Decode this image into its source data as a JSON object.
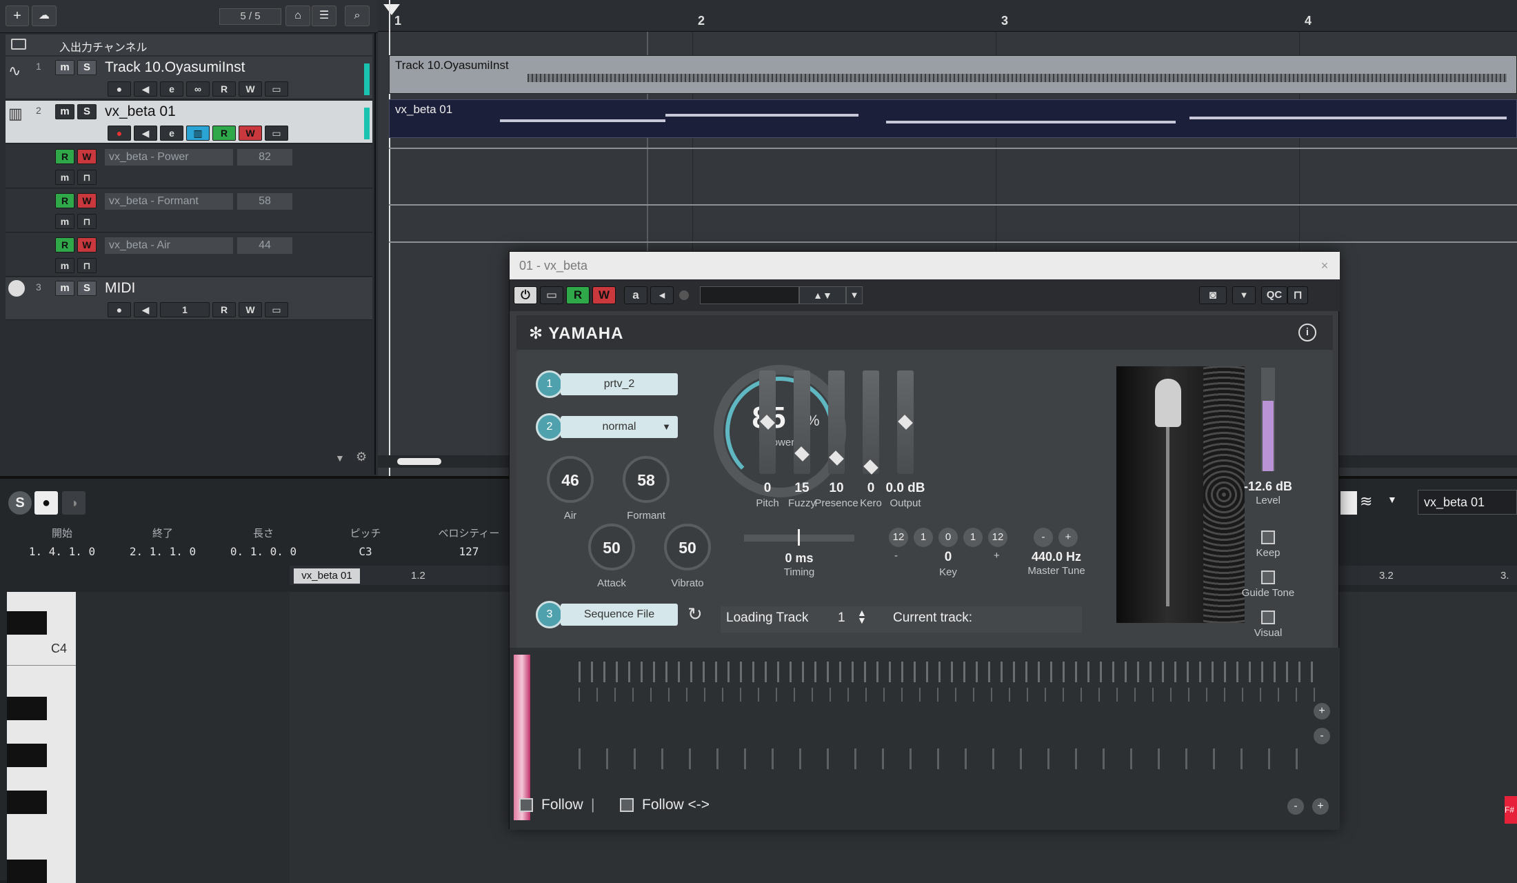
{
  "toolbar": {
    "add_label": "+",
    "counter": "5 / 5"
  },
  "track_list": {
    "folder_label": "入出力チャンネル",
    "tracks": [
      {
        "num": "1",
        "name": "Track 10.OyasumiInst",
        "m": "m",
        "s": "S",
        "r": "R",
        "w": "W"
      },
      {
        "num": "2",
        "name": "vx_beta 01",
        "m": "m",
        "s": "S",
        "r": "R",
        "w": "W"
      },
      {
        "num": "3",
        "name": "MIDI",
        "m": "m",
        "s": "S",
        "r": "R",
        "w": "W",
        "channel": "1"
      }
    ],
    "lanes": [
      {
        "name": "vx_beta - Power",
        "value": "82",
        "r": "R",
        "w": "W"
      },
      {
        "name": "vx_beta - Formant",
        "value": "58",
        "r": "R",
        "w": "W"
      },
      {
        "name": "vx_beta - Air",
        "value": "44",
        "r": "R",
        "w": "W"
      }
    ]
  },
  "ruler": {
    "bars": [
      "1",
      "2",
      "3",
      "4"
    ]
  },
  "clips": {
    "audio": "Track 10.OyasumiInst",
    "vocal": "vx_beta 01"
  },
  "editor": {
    "headers": [
      "開始",
      "終了",
      "長さ",
      "ピッチ",
      "ベロシティー"
    ],
    "values": [
      "1. 4. 1.   0",
      "2. 1. 1.   0",
      "0. 1. 0.   0",
      "C3",
      "127"
    ],
    "part_name": "vx_beta 01",
    "ruler_marks": [
      "1.2",
      "3.2",
      "3."
    ],
    "key_label": "C4",
    "track_name": "vx_beta 01",
    "note_flag": "F#"
  },
  "plugin": {
    "title": "01 - vx_beta",
    "toolbar": {
      "r": "R",
      "w": "W",
      "a": "a",
      "qc": "QC"
    },
    "brand": "YAMAHA",
    "voice": {
      "num": "1",
      "label": "prtv_2"
    },
    "style": {
      "num": "2",
      "label": "normal"
    },
    "sequence": {
      "num": "3",
      "label": "Sequence File"
    },
    "loading_track_label": "Loading Track",
    "loading_track_value": "1",
    "current_track_label": "Current track:",
    "power": {
      "value": "85",
      "unit": "%",
      "label": "Power",
      "level": 0.85
    },
    "knobs": [
      {
        "value": "46",
        "label": "Air"
      },
      {
        "value": "58",
        "label": "Formant"
      },
      {
        "value": "50",
        "label": "Attack"
      },
      {
        "value": "50",
        "label": "Vibrato"
      }
    ],
    "sliders": [
      {
        "value": "0",
        "label": "Pitch",
        "level": 0.5
      },
      {
        "value": "15",
        "label": "Fuzzy",
        "level": 0.15
      },
      {
        "value": "10",
        "label": "Presence",
        "level": 0.1
      },
      {
        "value": "0",
        "label": "Kero",
        "level": 0.0
      },
      {
        "value": "0.0 dB",
        "label": "Output",
        "level": 0.5
      }
    ],
    "timing": {
      "value": "0 ms",
      "label": "Timing"
    },
    "key": {
      "buttons_left": [
        "12",
        "1"
      ],
      "buttons_right": [
        "0",
        "1",
        "12"
      ],
      "minus": "-",
      "plus": "+",
      "value": "0",
      "label": "Key"
    },
    "master_tune": {
      "minus": "-",
      "plus": "+",
      "value": "440.0 Hz",
      "label": "Master Tune"
    },
    "level": {
      "value": "-12.6 dB",
      "label": "Level",
      "fill": 0.7
    },
    "checks": [
      {
        "label": "Keep"
      },
      {
        "label": "Guide Tone"
      },
      {
        "label": "Visual"
      }
    ],
    "follow1": "Follow",
    "follow_sep": "|",
    "follow2": "Follow <->",
    "zoom_minus": "-",
    "zoom_plus": "+"
  }
}
